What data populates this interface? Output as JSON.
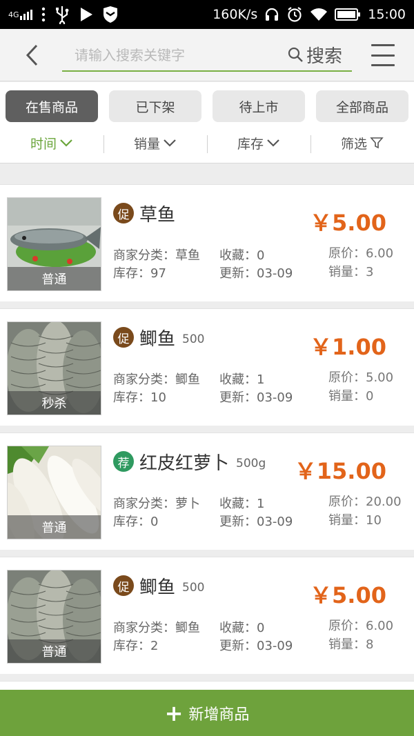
{
  "status_bar": {
    "network": "4G",
    "speed": "160K/s",
    "time": "15:00",
    "icons": [
      "signal-icon",
      "usb-icon",
      "play-icon",
      "shield-icon",
      "headset-icon",
      "alarm-icon",
      "wifi-icon",
      "battery-icon"
    ]
  },
  "header": {
    "search_placeholder": "请输入搜索关键字",
    "search_label": "搜索"
  },
  "tabs": [
    {
      "label": "在售商品",
      "active": true
    },
    {
      "label": "已下架",
      "active": false
    },
    {
      "label": "待上市",
      "active": false
    },
    {
      "label": "全部商品",
      "active": false
    }
  ],
  "sort": [
    {
      "label": "时间",
      "icon": "chevron-down-icon",
      "active": true
    },
    {
      "label": "销量",
      "icon": "chevron-down-icon",
      "active": false
    },
    {
      "label": "库存",
      "icon": "chevron-down-icon",
      "active": false
    },
    {
      "label": "筛选",
      "icon": "filter-icon",
      "active": false
    }
  ],
  "products": [
    {
      "badge": "促",
      "badge_type": "promo",
      "name": "草鱼",
      "spec": "",
      "thumb_label": "普通",
      "category_label": "商家分类：草鱼",
      "fav_label": "收藏：0",
      "stock_label": "库存：97",
      "update_label": "更新：03-09",
      "price": "￥5.00",
      "orig_label": "原价：6.00",
      "sales_label": "销量：3",
      "image": "fish"
    },
    {
      "badge": "促",
      "badge_type": "promo",
      "name": "鲫鱼",
      "spec": "500",
      "thumb_label": "秒杀",
      "category_label": "商家分类：鲫鱼",
      "fav_label": "收藏：1",
      "stock_label": "库存：10",
      "update_label": "更新：03-09",
      "price": "￥1.00",
      "orig_label": "原价：5.00",
      "sales_label": "销量：0",
      "image": "fish-scales"
    },
    {
      "badge": "荐",
      "badge_type": "rec",
      "name": "红皮红萝卜",
      "spec": "500g",
      "thumb_label": "普通",
      "category_label": "商家分类：萝卜",
      "fav_label": "收藏：1",
      "stock_label": "库存：0",
      "update_label": "更新：03-09",
      "price": "￥15.00",
      "orig_label": "原价：20.00",
      "sales_label": "销量：10",
      "image": "radish"
    },
    {
      "badge": "促",
      "badge_type": "promo",
      "name": "鲫鱼",
      "spec": "500",
      "thumb_label": "普通",
      "category_label": "商家分类：鲫鱼",
      "fav_label": "收藏：0",
      "stock_label": "库存：2",
      "update_label": "更新：03-09",
      "price": "￥5.00",
      "orig_label": "原价：6.00",
      "sales_label": "销量：8",
      "image": "fish-scales"
    }
  ],
  "footer": {
    "add_label": "新增商品"
  },
  "colors": {
    "accent": "#6ea23c",
    "price": "#e2641a",
    "promo_badge": "#7a4a1c",
    "rec_badge": "#2f9a60"
  }
}
